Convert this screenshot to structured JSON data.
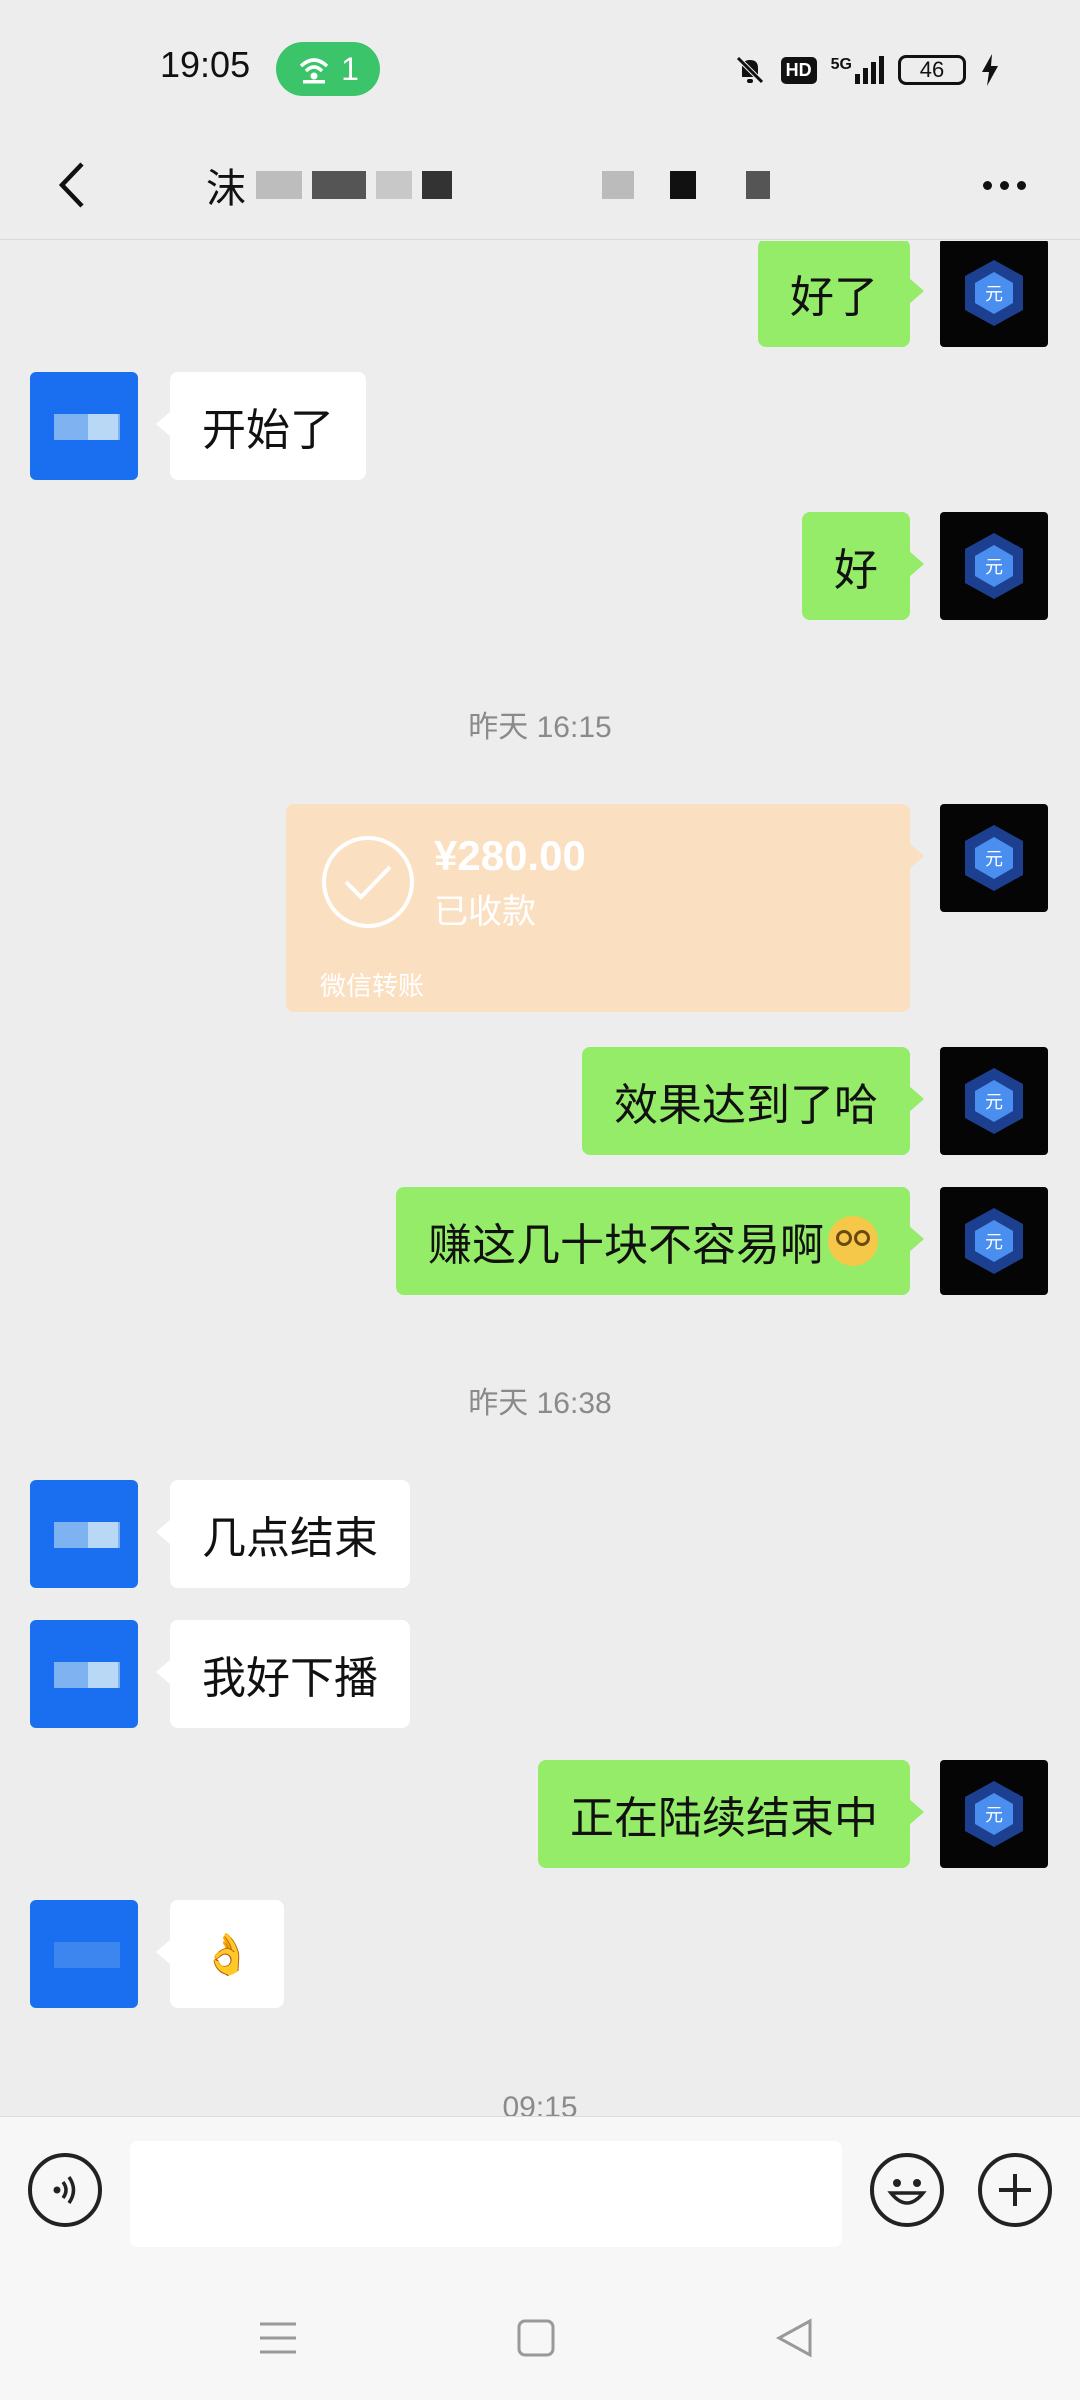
{
  "status_bar": {
    "time": "19:05",
    "hotspot_count": "1",
    "hd_label": "HD",
    "network": "5G",
    "battery": "46"
  },
  "header": {
    "title_prefix": "沫",
    "more_label": "..."
  },
  "messages": [
    {
      "side": "self",
      "text": "好了"
    },
    {
      "side": "other",
      "text": "开始了"
    },
    {
      "side": "self",
      "text": "好"
    },
    {
      "type": "timestamp",
      "text": "昨天 16:15"
    },
    {
      "side": "self",
      "type": "transfer",
      "amount": "¥280.00",
      "status": "已收款",
      "footer": "微信转账"
    },
    {
      "side": "self",
      "text": "效果达到了哈"
    },
    {
      "side": "self",
      "text": "赚这几十块不容易啊"
    },
    {
      "type": "timestamp",
      "text": "昨天 16:38"
    },
    {
      "side": "other",
      "text": "几点结束"
    },
    {
      "side": "other",
      "text": "我好下播"
    },
    {
      "side": "self",
      "text": "正在陆续结束中"
    },
    {
      "side": "other",
      "text": "👌"
    },
    {
      "type": "timestamp",
      "text": "09:15"
    }
  ],
  "self_avatar_glyph": "元",
  "colors": {
    "self_bubble": "#95ec69",
    "other_bubble": "#ffffff",
    "transfer_bubble": "#fbdfc1",
    "hotspot": "#3cc46a",
    "background": "#ededed"
  }
}
